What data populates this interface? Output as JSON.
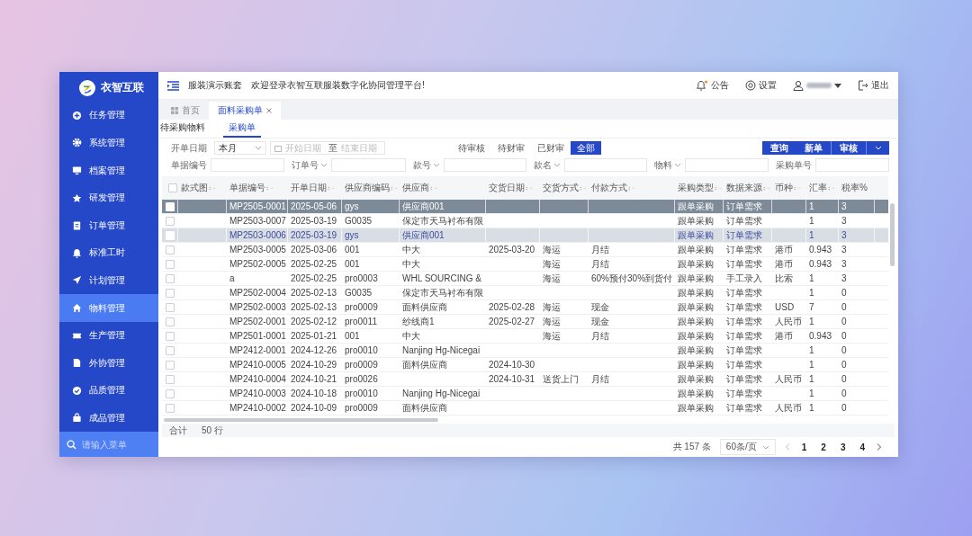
{
  "sidebar": {
    "brand": "衣智互联",
    "items": [
      {
        "label": "任务管理",
        "selected": false
      },
      {
        "label": "系统管理",
        "selected": false
      },
      {
        "label": "档案管理",
        "selected": false
      },
      {
        "label": "研发管理",
        "selected": false
      },
      {
        "label": "订单管理",
        "selected": false
      },
      {
        "label": "标准工时",
        "selected": false
      },
      {
        "label": "计划管理",
        "selected": false
      },
      {
        "label": "物料管理",
        "selected": true
      },
      {
        "label": "生产管理",
        "selected": false
      },
      {
        "label": "外协管理",
        "selected": false
      },
      {
        "label": "品质管理",
        "selected": false
      },
      {
        "label": "成品管理",
        "selected": false
      }
    ],
    "search": {
      "placeholder": "请输入菜单"
    }
  },
  "header": {
    "account": "服装演示账套",
    "welcome": "欢迎登录衣智互联服装数字化协同管理平台!",
    "notice": "公告",
    "settings": "设置",
    "logout": "退出"
  },
  "tabs": [
    {
      "label": "首页",
      "selected": false,
      "closable": false
    },
    {
      "label": "面料采购单",
      "selected": true,
      "closable": true
    }
  ],
  "subtabs": [
    {
      "label": "待采购物料",
      "selected": false
    },
    {
      "label": "采购单",
      "selected": true
    }
  ],
  "date_filter": {
    "label": "开单日期",
    "period": "本月",
    "start_placeholder": "开始日期",
    "separator": "至",
    "end_placeholder": "结束日期"
  },
  "status_tabs": [
    {
      "label": "待审核",
      "selected": false
    },
    {
      "label": "待财审",
      "selected": false
    },
    {
      "label": "已财审",
      "selected": false
    },
    {
      "label": "全部",
      "selected": true
    }
  ],
  "actions": [
    "查询",
    "新单",
    "审核"
  ],
  "search_fields": [
    {
      "label": "单据编号",
      "dropdown": false
    },
    {
      "label": "订单号",
      "dropdown": true
    },
    {
      "label": "款号",
      "dropdown": true
    },
    {
      "label": "款名",
      "dropdown": true
    },
    {
      "label": "物料",
      "dropdown": true
    },
    {
      "label": "采购单号",
      "dropdown": false
    }
  ],
  "table": {
    "all_checked": false,
    "columns": [
      {
        "label": "款式图"
      },
      {
        "label": "单据编号"
      },
      {
        "label": "开单日期"
      },
      {
        "label": "供应商编码"
      },
      {
        "label": "供应商"
      },
      {
        "label": "交货日期"
      },
      {
        "label": "交货方式"
      },
      {
        "label": "付款方式"
      },
      {
        "label": "采购类型"
      },
      {
        "label": "数据来源"
      },
      {
        "label": "币种"
      },
      {
        "label": "汇率"
      },
      {
        "label": "税率%"
      }
    ],
    "rows": [
      {
        "selected": true,
        "highlighted": false,
        "checked": false,
        "order_no": "MP2505-0001",
        "open_date": "2025-05-06",
        "supplier_code": "gys",
        "supplier": "供应商001",
        "purchase_type": "跟单采购",
        "data_source": "订单需求",
        "rate": "1",
        "tax": "3"
      },
      {
        "selected": false,
        "highlighted": false,
        "checked": false,
        "order_no": "MP2503-0007",
        "open_date": "2025-03-19",
        "supplier_code": "G0035",
        "supplier": "保定市天马衬布有限",
        "purchase_type": "跟单采购",
        "data_source": "订单需求",
        "rate": "1",
        "tax": "3"
      },
      {
        "selected": false,
        "highlighted": true,
        "checked": false,
        "order_no": "MP2503-0006",
        "open_date": "2025-03-19",
        "supplier_code": "gys",
        "supplier": "供应商001",
        "purchase_type": "跟单采购",
        "data_source": "订单需求",
        "rate": "1",
        "tax": "3"
      },
      {
        "selected": false,
        "highlighted": false,
        "checked": false,
        "order_no": "MP2503-0005",
        "open_date": "2025-03-06",
        "supplier_code": "001",
        "supplier": "中大",
        "delivery_date": "2025-03-20",
        "delivery_method": "海运",
        "payment_method": "月结",
        "purchase_type": "跟单采购",
        "data_source": "订单需求",
        "currency": "港币",
        "rate": "0.943",
        "tax": "3"
      },
      {
        "selected": false,
        "highlighted": false,
        "checked": false,
        "order_no": "MP2502-0005",
        "open_date": "2025-02-25",
        "supplier_code": "001",
        "supplier": "中大",
        "delivery_method": "海运",
        "payment_method": "月结",
        "purchase_type": "跟单采购",
        "data_source": "订单需求",
        "currency": "港币",
        "rate": "0.943",
        "tax": "3"
      },
      {
        "selected": false,
        "highlighted": false,
        "checked": false,
        "order_no": "a",
        "open_date": "2025-02-25",
        "supplier_code": "pro0003",
        "supplier": "WHL SOURCING &",
        "delivery_method": "海运",
        "payment_method": "60%预付30%到货付",
        "purchase_type": "跟单采购",
        "data_source": "手工录入",
        "currency": "比索",
        "rate": "1",
        "tax": "3"
      },
      {
        "selected": false,
        "highlighted": false,
        "checked": false,
        "order_no": "MP2502-0004",
        "open_date": "2025-02-13",
        "supplier_code": "G0035",
        "supplier": "保定市天马衬布有限",
        "purchase_type": "跟单采购",
        "data_source": "订单需求",
        "rate": "1",
        "tax": "0"
      },
      {
        "selected": false,
        "highlighted": false,
        "checked": false,
        "order_no": "MP2502-0003",
        "open_date": "2025-02-13",
        "supplier_code": "pro0009",
        "supplier": "面料供应商",
        "delivery_date": "2025-02-28",
        "delivery_method": "海运",
        "payment_method": "现金",
        "purchase_type": "跟单采购",
        "data_source": "订单需求",
        "currency": "USD",
        "rate": "7",
        "tax": "0"
      },
      {
        "selected": false,
        "highlighted": false,
        "checked": false,
        "order_no": "MP2502-0001",
        "open_date": "2025-02-12",
        "supplier_code": "pro0011",
        "supplier": "纱线商1",
        "delivery_date": "2025-02-27",
        "delivery_method": "海运",
        "payment_method": "现金",
        "purchase_type": "跟单采购",
        "data_source": "订单需求",
        "currency": "人民币",
        "rate": "1",
        "tax": "0"
      },
      {
        "selected": false,
        "highlighted": false,
        "checked": false,
        "order_no": "MP2501-0001",
        "open_date": "2025-01-21",
        "supplier_code": "001",
        "supplier": "中大",
        "delivery_method": "海运",
        "payment_method": "月结",
        "purchase_type": "跟单采购",
        "data_source": "订单需求",
        "currency": "港币",
        "rate": "0.943",
        "tax": "0"
      },
      {
        "selected": false,
        "highlighted": false,
        "checked": false,
        "order_no": "MP2412-0001",
        "open_date": "2024-12-26",
        "supplier_code": "pro0010",
        "supplier": "Nanjing Hg-Nicegai",
        "purchase_type": "跟单采购",
        "data_source": "订单需求",
        "rate": "1",
        "tax": "0"
      },
      {
        "selected": false,
        "highlighted": false,
        "checked": false,
        "order_no": "MP2410-0005",
        "open_date": "2024-10-29",
        "supplier_code": "pro0009",
        "supplier": "面料供应商",
        "delivery_date": "2024-10-30",
        "purchase_type": "跟单采购",
        "data_source": "订单需求",
        "rate": "1",
        "tax": "0"
      },
      {
        "selected": false,
        "highlighted": false,
        "checked": false,
        "order_no": "MP2410-0004",
        "open_date": "2024-10-21",
        "supplier_code": "pro0026",
        "delivery_date": "2024-10-31",
        "delivery_method": "送货上门",
        "payment_method": "月结",
        "purchase_type": "跟单采购",
        "data_source": "订单需求",
        "currency": "人民币",
        "rate": "1",
        "tax": "0"
      },
      {
        "selected": false,
        "highlighted": false,
        "checked": false,
        "order_no": "MP2410-0003",
        "open_date": "2024-10-18",
        "supplier_code": "pro0010",
        "supplier": "Nanjing Hg-Nicegai",
        "purchase_type": "跟单采购",
        "data_source": "订单需求",
        "rate": "1",
        "tax": "0"
      },
      {
        "selected": false,
        "highlighted": false,
        "checked": false,
        "order_no": "MP2410-0002",
        "open_date": "2024-10-09",
        "supplier_code": "pro0009",
        "supplier": "面料供应商",
        "purchase_type": "跟单采购",
        "data_source": "订单需求",
        "currency": "人民币",
        "rate": "1",
        "tax": "0"
      }
    ]
  },
  "summary": {
    "label": "合计",
    "rows": "50 行"
  },
  "pagination": {
    "total": "共 157 条",
    "page_size": "60条/页",
    "pages": [
      "1",
      "2",
      "3",
      "4"
    ]
  }
}
